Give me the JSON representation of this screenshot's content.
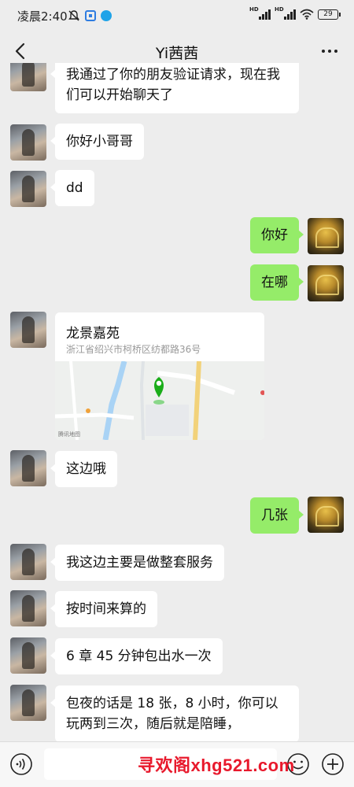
{
  "status_bar": {
    "time": "凌晨2:40",
    "battery": "29",
    "hd_label": "HD"
  },
  "header": {
    "title": "Yi茜茜"
  },
  "messages": [
    {
      "from": "contact",
      "text": "我通过了你的朋友验证请求，现在我们可以开始聊天了"
    },
    {
      "from": "contact",
      "text": "你好小哥哥"
    },
    {
      "from": "contact",
      "text": "dd"
    },
    {
      "from": "me",
      "text": "你好"
    },
    {
      "from": "me",
      "text": "在哪"
    },
    {
      "from": "contact",
      "type": "location",
      "name": "龙景嘉苑",
      "address": "浙江省绍兴市柯桥区纺都路36号",
      "map_attribution": "腾讯地图"
    },
    {
      "from": "contact",
      "text": "这边哦"
    },
    {
      "from": "me",
      "text": "几张"
    },
    {
      "from": "contact",
      "text": "我这边主要是做整套服务"
    },
    {
      "from": "contact",
      "text": "按时间来算的"
    },
    {
      "from": "contact",
      "text": "6 章 45 分钟包出水一次"
    },
    {
      "from": "contact",
      "text": "包夜的话是 18 张，8 小时，你可以玩两到三次，随后就是陪睡，"
    }
  ],
  "input_bar": {
    "placeholder": ""
  },
  "watermark": "寻欢阁xhg521.com",
  "colors": {
    "background": "#ededed",
    "sent_bubble": "#95ec69",
    "received_bubble": "#ffffff",
    "map_pin": "#1aad19",
    "watermark": "#e8192c"
  }
}
